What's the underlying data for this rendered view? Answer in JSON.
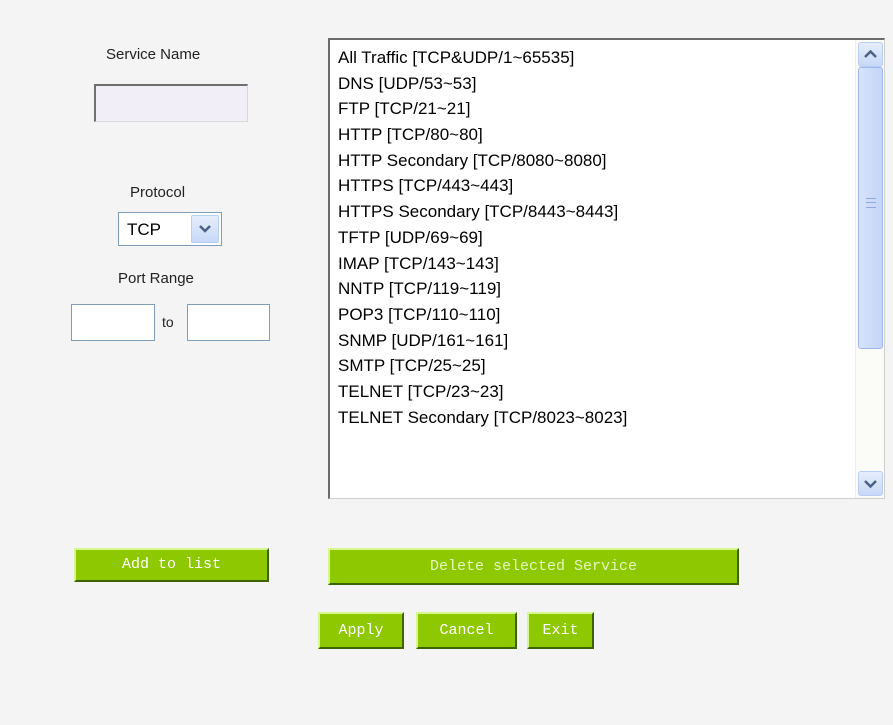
{
  "form": {
    "service_name_label": "Service Name",
    "service_name_value": "",
    "protocol_label": "Protocol",
    "protocol_selected": "TCP",
    "port_range_label": "Port Range",
    "port_from_value": "",
    "to_label": "to",
    "port_to_value": ""
  },
  "services": [
    "All Traffic [TCP&UDP/1~65535]",
    "DNS [UDP/53~53]",
    "FTP [TCP/21~21]",
    "HTTP [TCP/80~80]",
    "HTTP Secondary [TCP/8080~8080]",
    "HTTPS [TCP/443~443]",
    "HTTPS Secondary [TCP/8443~8443]",
    "TFTP [UDP/69~69]",
    "IMAP [TCP/143~143]",
    "NNTP [TCP/119~119]",
    "POP3 [TCP/110~110]",
    "SNMP [UDP/161~161]",
    "SMTP [TCP/25~25]",
    "TELNET [TCP/23~23]",
    "TELNET Secondary [TCP/8023~8023]"
  ],
  "buttons": {
    "add": "Add to list",
    "delete": "Delete selected Service",
    "apply": "Apply",
    "cancel": "Cancel",
    "exit": "Exit"
  },
  "icons": {
    "dropdown": "chevron-down-icon",
    "scroll_up": "chevron-up-icon",
    "scroll_down": "chevron-down-icon"
  },
  "colors": {
    "button_green": "#8ec800",
    "page_bg": "#f4f4f4"
  }
}
